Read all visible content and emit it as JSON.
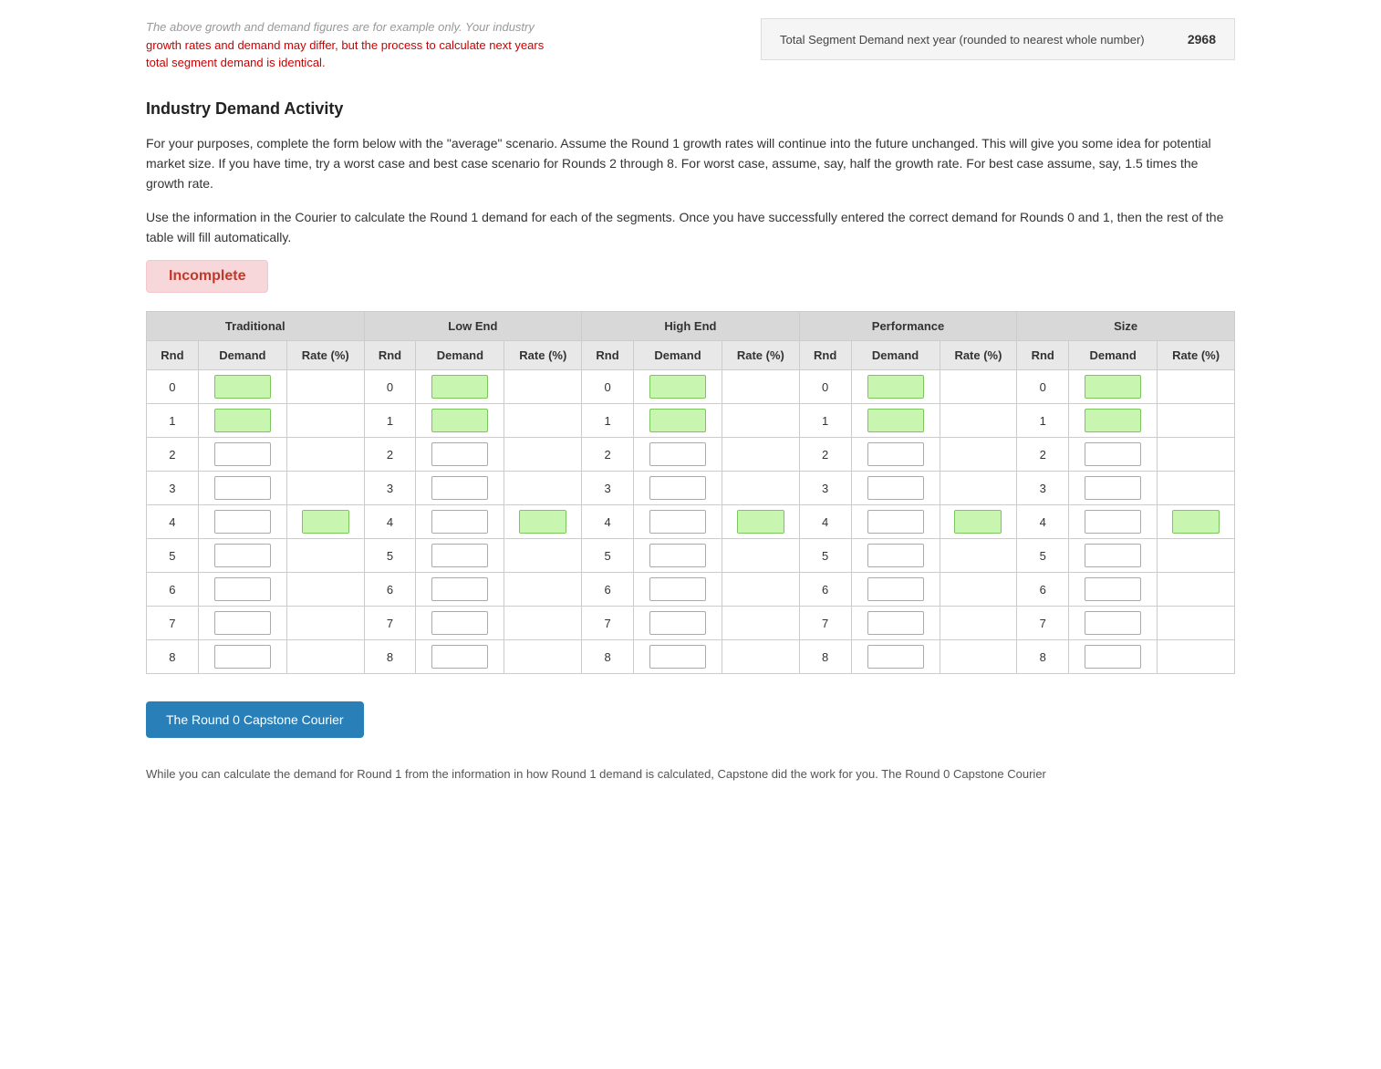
{
  "top_notice": {
    "line1": "The above growth and demand figures are for example only. Your industry",
    "line2": "growth rates and demand may differ, but the process to calculate next years",
    "line3": "total segment demand is identical."
  },
  "segment_demand": {
    "label": "Total Segment Demand next year (rounded to nearest whole number)",
    "value": "2968"
  },
  "section_title": "Industry Demand Activity",
  "description1": "For your purposes, complete the form below with the \"average\" scenario. Assume the Round 1 growth rates will continue into the future unchanged. This will give you some idea for potential market size. If you have time, try a worst case and best case scenario for Rounds 2 through 8. For worst case, assume, say, half the growth rate. For best case assume, say, 1.5 times the growth rate.",
  "description2": "Use the information in the Courier to calculate the Round 1 demand for each of the segments. Once you have successfully entered the correct demand for Rounds 0 and 1, then the rest of the table will fill automatically.",
  "status_badge": "Incomplete",
  "segments": [
    {
      "id": "traditional",
      "label": "Traditional"
    },
    {
      "id": "low_end",
      "label": "Low End"
    },
    {
      "id": "high_end",
      "label": "High End"
    },
    {
      "id": "performance",
      "label": "Performance"
    },
    {
      "id": "size",
      "label": "Size"
    }
  ],
  "col_headers": {
    "rnd": "Rnd",
    "demand": "Demand",
    "rate": "Rate (%)"
  },
  "rows": [
    0,
    1,
    2,
    3,
    4,
    5,
    6,
    7,
    8
  ],
  "green_demand_rows": [
    0,
    1
  ],
  "green_rate_rows": [
    4
  ],
  "courier_button_label": "The Round 0 Capstone Courier",
  "bottom_note": "While you can calculate the demand for Round 1 from the information in how Round 1 demand is calculated, Capstone did the work for you. The Round 0 Capstone Courier"
}
